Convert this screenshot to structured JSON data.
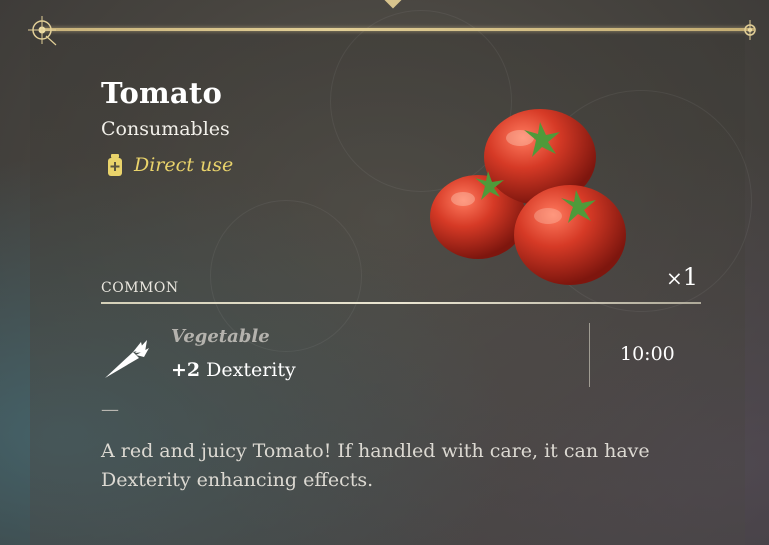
{
  "item": {
    "name": "Tomato",
    "category": "Consumables",
    "usage": "Direct use",
    "rarity": "COMMON",
    "quantity_prefix": "×",
    "quantity": "1"
  },
  "effect": {
    "food_type": "Vegetable",
    "stat_value": "+2",
    "stat_name": "Dexterity",
    "duration": "10:00"
  },
  "separator": "—",
  "description": "A red and juicy Tomato! If handled with care, it can have Dexterity enhancing effects.",
  "colors": {
    "frame_gold": "#e2cf97",
    "usage_yellow": "#e9d36b",
    "title_white": "#ffffff"
  },
  "icons": {
    "usage": "potion-bottle-icon",
    "effect": "carrot-icon",
    "item": "tomato-image"
  }
}
